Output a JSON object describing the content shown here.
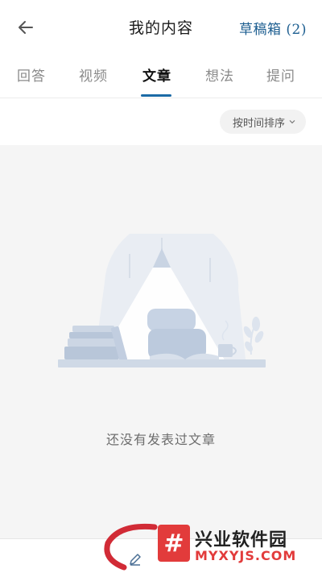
{
  "header": {
    "title": "我的内容",
    "drafts_label": "草稿箱 (2)"
  },
  "tabs": [
    {
      "label": "回答",
      "active": false
    },
    {
      "label": "视频",
      "active": false
    },
    {
      "label": "文章",
      "active": true
    },
    {
      "label": "想法",
      "active": false
    },
    {
      "label": "提问",
      "active": false
    }
  ],
  "sort": {
    "label": "按时间排序",
    "icon": "chevron-down-icon"
  },
  "empty_state": {
    "message": "还没有发表过文章"
  },
  "bottom": {
    "write_icon": "edit-icon"
  },
  "watermark": {
    "symbol": "#",
    "title": "兴业软件园",
    "url": "MYXYJS.COM"
  },
  "colors": {
    "accent": "#1b6aa6",
    "drafts": "#1e5f91",
    "content_bg": "#f5f5f5",
    "watermark_red": "#e23b3b"
  }
}
